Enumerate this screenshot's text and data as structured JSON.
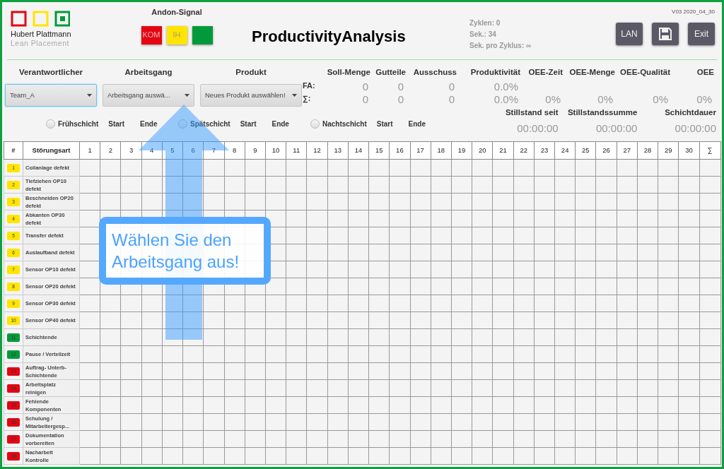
{
  "logo": {
    "name": "Hubert Plattmann",
    "tagline": "Lean Placement"
  },
  "andon": {
    "title": "Andon-Signal",
    "lights": [
      {
        "label": "KOM",
        "color": "#e30613"
      },
      {
        "label": "IH",
        "color": "#ffe500"
      },
      {
        "color": "#009a3a"
      }
    ]
  },
  "app_title": "ProductivityAnalysis",
  "stats": [
    "Zyklen: 0",
    "Sek.: 34",
    "Sek. pro Zyklus: ∞"
  ],
  "version": "V03 2020_04_30",
  "toolbar": [
    {
      "kind": "text",
      "label": "LAN"
    },
    {
      "kind": "save"
    },
    {
      "kind": "text",
      "label": "Exit"
    }
  ],
  "selectors": [
    {
      "label": "Verantwortlicher",
      "value": "Team_A",
      "focused": true
    },
    {
      "label": "Arbeitsgang",
      "value": "Arbeitsgang auswä...",
      "focused": false
    },
    {
      "label": "Produkt",
      "value": "Neues Produkt auswählen!",
      "focused": false
    }
  ],
  "metrics": {
    "row_labels": [
      "FA:",
      "∑:"
    ],
    "columns": [
      {
        "label": "Soll-Menge",
        "fa": "0",
        "sum": "0"
      },
      {
        "label": "Gutteile",
        "fa": "0",
        "sum": "0"
      },
      {
        "label": "Ausschuss",
        "fa": "0",
        "sum": "0"
      },
      {
        "label": "Produktivität",
        "fa": "0.0%",
        "sum": "0.0%"
      },
      {
        "label": "OEE-Zeit",
        "sum": "0%"
      },
      {
        "label": "OEE-Menge",
        "sum": "0%"
      },
      {
        "label": "OEE-Qualität",
        "sum": "0%"
      },
      {
        "label": "OEE",
        "sum": "0%"
      }
    ]
  },
  "shifts": [
    {
      "label": "Frühschicht",
      "selected": false,
      "start": "Start",
      "end": "Ende"
    },
    {
      "label": "Spätschicht",
      "selected": false,
      "start": "Start",
      "end": "Ende"
    },
    {
      "label": "Nachtschicht",
      "selected": false,
      "start": "Start",
      "end": "Ende"
    }
  ],
  "timers": [
    {
      "label": "Stillstand seit",
      "value": "00:00:00"
    },
    {
      "label": "Stillstandssumme",
      "value": "00:00:00"
    },
    {
      "label": "Schichtdauer",
      "value": "00:00:00"
    }
  ],
  "table": {
    "columns": [
      "#",
      "Störungsart",
      "1",
      "2",
      "3",
      "4",
      "5",
      "6",
      "7",
      "8",
      "9",
      "10",
      "11",
      "12",
      "13",
      "14",
      "15",
      "16",
      "17",
      "18",
      "19",
      "20",
      "21",
      "22",
      "23",
      "24",
      "25",
      "26",
      "27",
      "28",
      "29",
      "30",
      "∑"
    ],
    "rows": [
      {
        "number": "1",
        "label": "Coilanlage defekt",
        "color": "#ffe500"
      },
      {
        "number": "2",
        "label": "Tiefziehen OP10 defekt",
        "color": "#ffe500"
      },
      {
        "number": "3",
        "label": "Beschneiden OP20 defekt",
        "color": "#ffe500"
      },
      {
        "number": "4",
        "label": "Abkanten OP30 defekt",
        "color": "#ffe500"
      },
      {
        "number": "5",
        "label": "Transfer defekt",
        "color": "#ffe500"
      },
      {
        "number": "6",
        "label": "Auslaufband defekt",
        "color": "#ffe500"
      },
      {
        "number": "7",
        "label": "Sensor OP10 defekt",
        "color": "#ffe500"
      },
      {
        "number": "8",
        "label": "Sensor OP20 defekt",
        "color": "#ffe500"
      },
      {
        "number": "9",
        "label": "Sensor OP30 defekt",
        "color": "#ffe500"
      },
      {
        "number": "10",
        "label": "Sensor OP40 defekt",
        "color": "#ffe500"
      },
      {
        "number": "11",
        "label": "Schichtende",
        "color": "#009a3a"
      },
      {
        "number": "12",
        "label": "Pause / Verteilzeit",
        "color": "#009a3a"
      },
      {
        "number": "13",
        "label": "Auftrag- Unterb-Schichtende",
        "color": "#e30613"
      },
      {
        "number": "14",
        "label": "Arbeitsplatz reinigen",
        "color": "#e30613"
      },
      {
        "number": "15",
        "label": "Fehlende Komponenten",
        "color": "#e30613"
      },
      {
        "number": "16",
        "label": "Schulung / Mitarbeitergesp...",
        "color": "#e30613"
      },
      {
        "number": "17",
        "label": "Dokumentation vorbereiten",
        "color": "#e30613"
      },
      {
        "number": "18",
        "label": "Nacharbeit Kontrolle",
        "color": "#e30613"
      }
    ]
  },
  "hint": {
    "text": "Wählen Sie den Arbeitsgang aus!"
  }
}
